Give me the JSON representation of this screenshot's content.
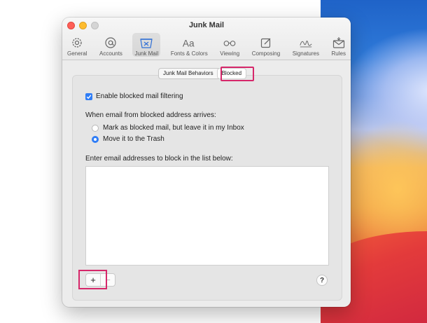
{
  "window": {
    "title": "Junk Mail"
  },
  "toolbar": {
    "items": [
      {
        "label": "General",
        "icon": "gear-icon"
      },
      {
        "label": "Accounts",
        "icon": "at-icon"
      },
      {
        "label": "Junk Mail",
        "icon": "junk-tray-icon",
        "active": true
      },
      {
        "label": "Fonts & Colors",
        "icon": "font-icon"
      },
      {
        "label": "Viewing",
        "icon": "glasses-icon"
      },
      {
        "label": "Composing",
        "icon": "compose-icon"
      },
      {
        "label": "Signatures",
        "icon": "signature-icon"
      },
      {
        "label": "Rules",
        "icon": "rules-envelope-icon"
      }
    ]
  },
  "tabs": {
    "behaviors": "Junk Mail Behaviors",
    "blocked": "Blocked",
    "selected": "Blocked"
  },
  "blocked": {
    "enable_label": "Enable blocked mail filtering",
    "enable_checked": true,
    "arrives_label": "When email from blocked address arrives:",
    "option_mark": "Mark as blocked mail, but leave it in my Inbox",
    "option_trash": "Move it to the Trash",
    "selected_option": "option_trash",
    "list_label": "Enter email addresses to block in the list below:",
    "addresses": [],
    "add_label": "+",
    "remove_label": "−",
    "help_label": "?"
  },
  "colors": {
    "accent": "#2f7df6",
    "highlight": "#d6276a"
  }
}
